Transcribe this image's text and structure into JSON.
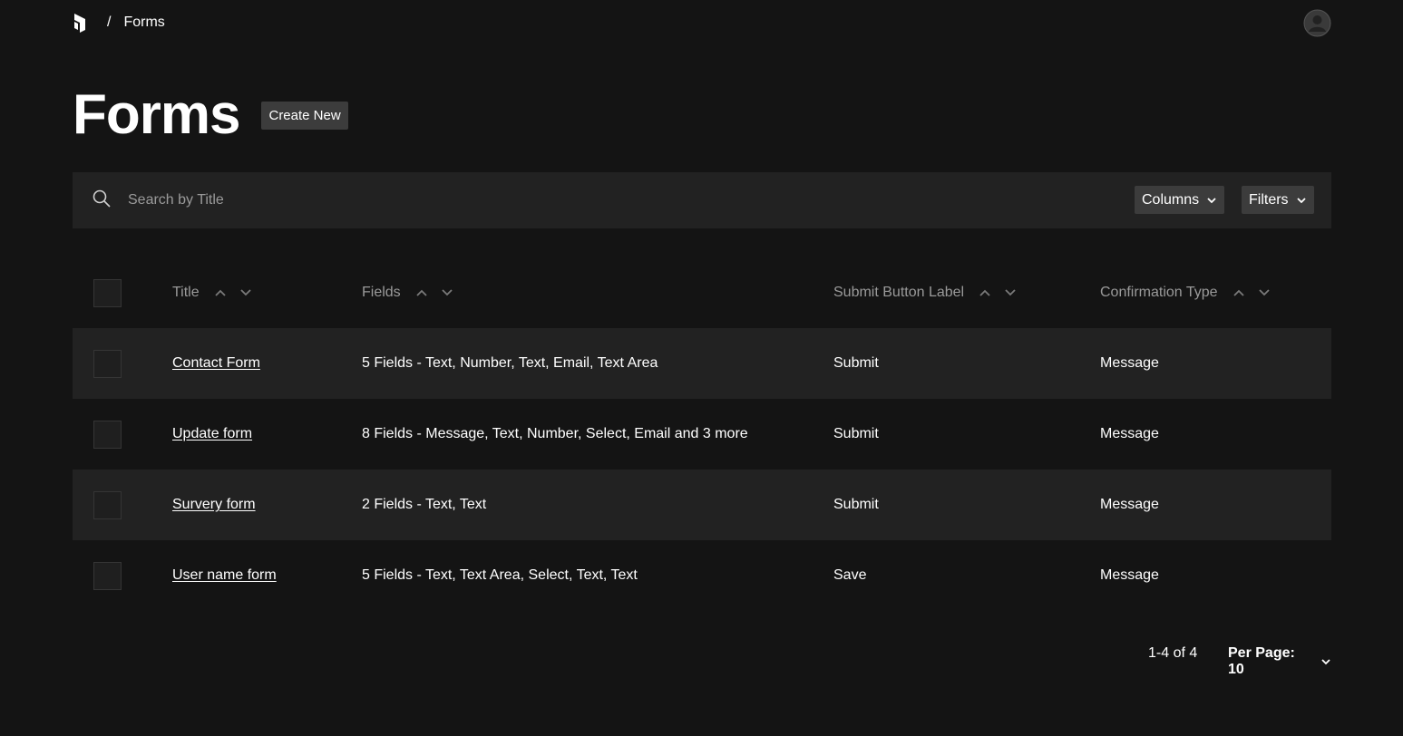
{
  "breadcrumb": {
    "separator": "/",
    "current": "Forms"
  },
  "header": {
    "title": "Forms",
    "create_label": "Create New"
  },
  "toolbar": {
    "search_placeholder": "Search by Title",
    "columns_label": "Columns",
    "filters_label": "Filters"
  },
  "table": {
    "columns": [
      "Title",
      "Fields",
      "Submit Button Label",
      "Confirmation Type"
    ],
    "rows": [
      {
        "title": "Contact Form",
        "fields": "5 Fields - Text, Number, Text, Email, Text Area",
        "submit": "Submit",
        "confirmation": "Message"
      },
      {
        "title": "Update form",
        "fields": "8 Fields - Message, Text, Number, Select, Email and 3 more",
        "submit": "Submit",
        "confirmation": "Message"
      },
      {
        "title": "Survery form",
        "fields": "2 Fields - Text, Text",
        "submit": "Submit",
        "confirmation": "Message"
      },
      {
        "title": "User name form",
        "fields": "5 Fields - Text, Text Area, Select, Text, Text",
        "submit": "Save",
        "confirmation": "Message"
      }
    ]
  },
  "pagination": {
    "range": "1-4 of 4",
    "per_page": "Per Page: 10"
  },
  "icons": {
    "logo": "payload-logo",
    "avatar": "user-avatar-icon",
    "search": "search-icon",
    "sort_up": "chevron-up-icon",
    "sort_down": "chevron-down-icon"
  },
  "colors": {
    "background": "#141414",
    "surface": "#222222",
    "button": "#3c3c3c",
    "muted_text": "#9a9a9a"
  }
}
